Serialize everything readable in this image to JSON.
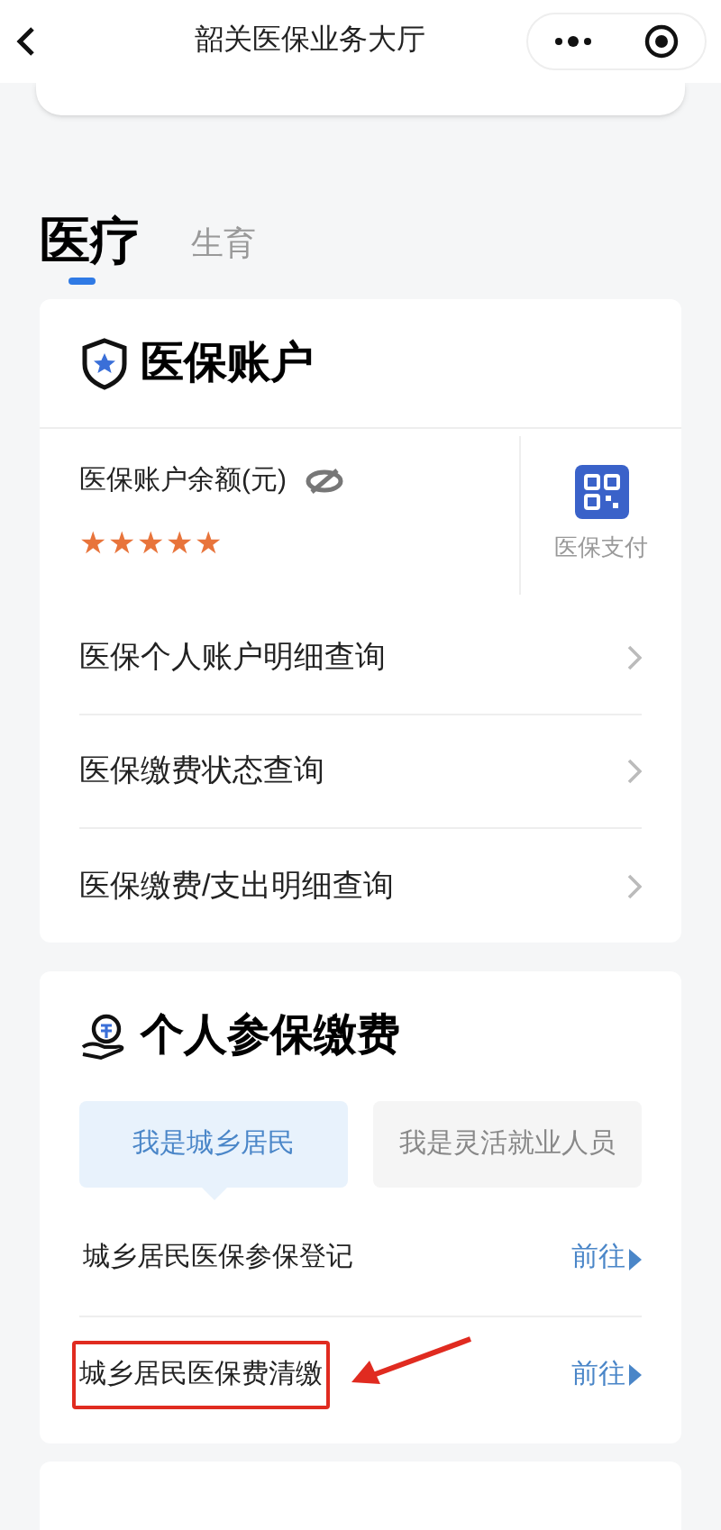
{
  "nav": {
    "title": "韶关医保业务大厅"
  },
  "tabs": [
    {
      "label": "医疗",
      "selected": true
    },
    {
      "label": "生育",
      "selected": false
    }
  ],
  "account": {
    "title": "医保账户",
    "balance_label": "医保账户余额(元)",
    "balance": "★★★★★",
    "pay_label": "医保支付",
    "links": [
      {
        "label": "医保个人账户明细查询"
      },
      {
        "label": "医保缴费状态查询"
      },
      {
        "label": "医保缴费/支出明细查询"
      }
    ]
  },
  "payment": {
    "title": "个人参保缴费",
    "options": [
      {
        "label": "我是城乡居民",
        "selected": true
      },
      {
        "label": "我是灵活就业人员",
        "selected": false
      }
    ],
    "items": [
      {
        "label": "城乡居民医保参保登记",
        "action": "前往",
        "highlighted": false
      },
      {
        "label": "城乡居民医保费清缴",
        "action": "前往",
        "highlighted": true
      }
    ]
  }
}
